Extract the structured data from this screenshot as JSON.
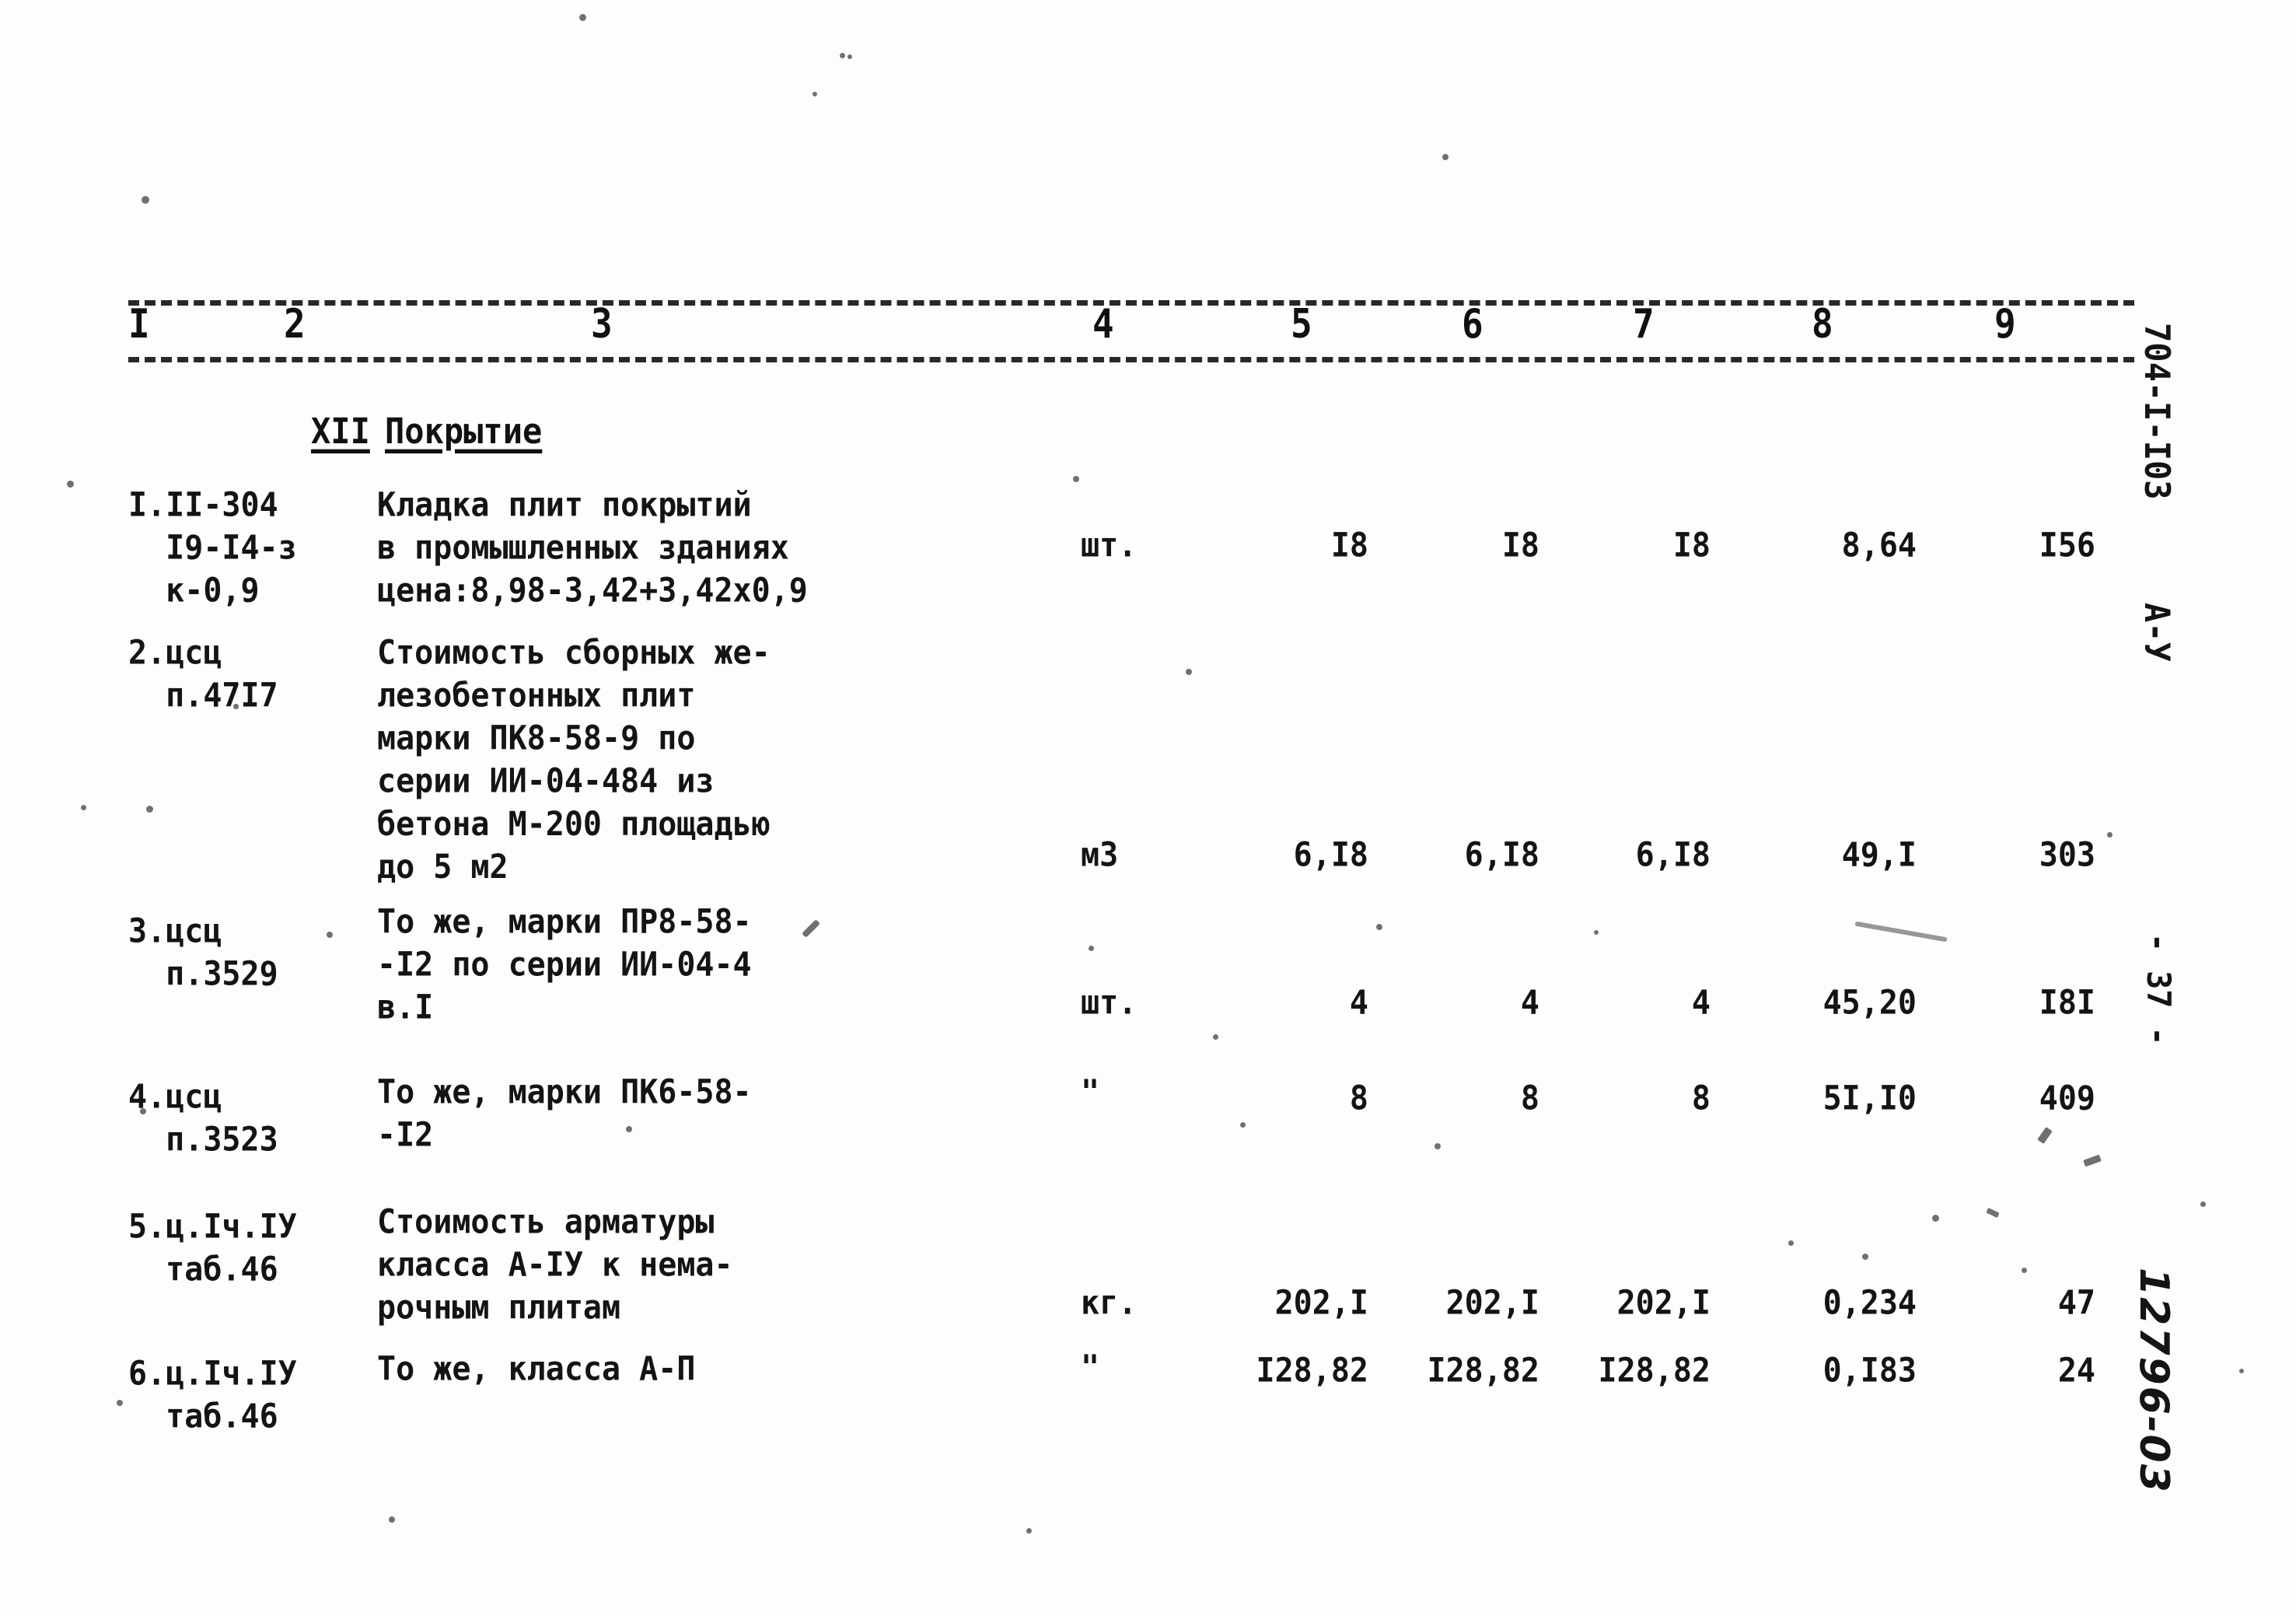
{
  "document": {
    "margin_notes": {
      "doc_code": "704-I-I03",
      "series": "А-У",
      "page_number": "- 37 -",
      "archive_code": "12796-03"
    }
  },
  "table": {
    "column_numbers": [
      "I",
      "2",
      "3",
      "4",
      "5",
      "6",
      "7",
      "8",
      "9"
    ],
    "section": {
      "number": "XII",
      "title": "Покрытие"
    },
    "rows": [
      {
        "code": "I.II-304\n  I9-I4-з\n  к-0,9",
        "description": "Кладка плит покрытий\nв промышленных зданиях\nцена:8,98-3,42+3,42х0,9",
        "unit": "шт.",
        "col5": "I8",
        "col6": "I8",
        "col7": "I8",
        "col8": "8,64",
        "col9": "I56"
      },
      {
        "code": "2.цсц\n  п.47I7",
        "description": "Стоимость сборных же-\nлезобетонных плит\nмарки ПК8-58-9 по\nсерии ИИ-04-484 из\nбетона М-200 площадью\nдо 5 м2",
        "unit": "м3",
        "col5": "6,I8",
        "col6": "6,I8",
        "col7": "6,I8",
        "col8": "49,I",
        "col9": "303"
      },
      {
        "code": "3.цсц\n  п.3529",
        "description": "То же, марки ПР8-58-\n-I2 по серии ИИ-04-4\nв.I",
        "unit": "шт.",
        "col5": "4",
        "col6": "4",
        "col7": "4",
        "col8": "45,20",
        "col9": "I8I"
      },
      {
        "code": "4.цсц\n  п.3523",
        "description": "То же, марки ПК6-58-\n-I2",
        "unit": "\"",
        "col5": "8",
        "col6": "8",
        "col7": "8",
        "col8": "5I,I0",
        "col9": "409"
      },
      {
        "code": "5.ц.Iч.IУ\n  таб.46",
        "description": "Стоимость арматуры\nкласса А-IУ к нема-\nрочным плитам",
        "unit": "кг.",
        "col5": "202,I",
        "col6": "202,I",
        "col7": "202,I",
        "col8": "0,234",
        "col9": "47"
      },
      {
        "code": "6.ц.Iч.IУ\n  таб.46",
        "description": "То же, класса А-П",
        "unit": "\"",
        "col5": "I28,82",
        "col6": "I28,82",
        "col7": "I28,82",
        "col8": "0,I83",
        "col9": "24"
      }
    ]
  }
}
